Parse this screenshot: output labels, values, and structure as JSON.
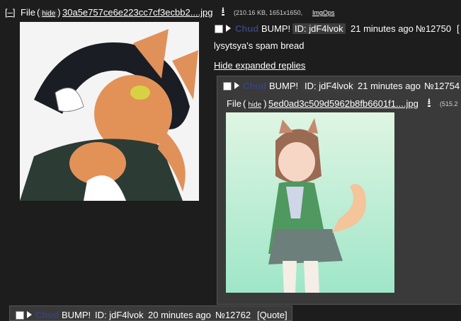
{
  "op": {
    "collapse_label": "[–]",
    "file_label": "File",
    "hide_label": "hide",
    "filename": "30a5e757ce6e223cc7cf3ecbb2....jpg",
    "meta": "(210.16 KB, 1651x1650,",
    "imgops": "ImgOps",
    "name": "Chud",
    "bump": "BUMP!",
    "id_label": "ID: jdF4lvok",
    "time": "21 minutes ago",
    "post_no": "№12750",
    "bracket": "[",
    "body": "lysytsya's spam bread",
    "hide_replies": "Hide expanded replies"
  },
  "reply": {
    "name": "Chud",
    "bump": "BUMP!",
    "id_label": "ID: jdF4lvok",
    "time": "21 minutes ago",
    "post_no": "№12754",
    "file_label": "File",
    "hide_label": "hide",
    "filename": "5ed0ad3c509d5962b8fb6601f1....jpg",
    "meta": "(515.2"
  },
  "next_post": {
    "name": "Chud",
    "bump": "BUMP!",
    "id_label": "ID: jdF4lvok",
    "time": "20 minutes ago",
    "post_no": "№12762",
    "quote": "[Quote]"
  },
  "colors": {
    "background": "#1d1d1d",
    "reply_background": "#3a3a3a",
    "name": "#36437a",
    "text": "#ffffff"
  },
  "icons": [
    "download-icon",
    "expand-triangle-icon",
    "checkbox"
  ]
}
